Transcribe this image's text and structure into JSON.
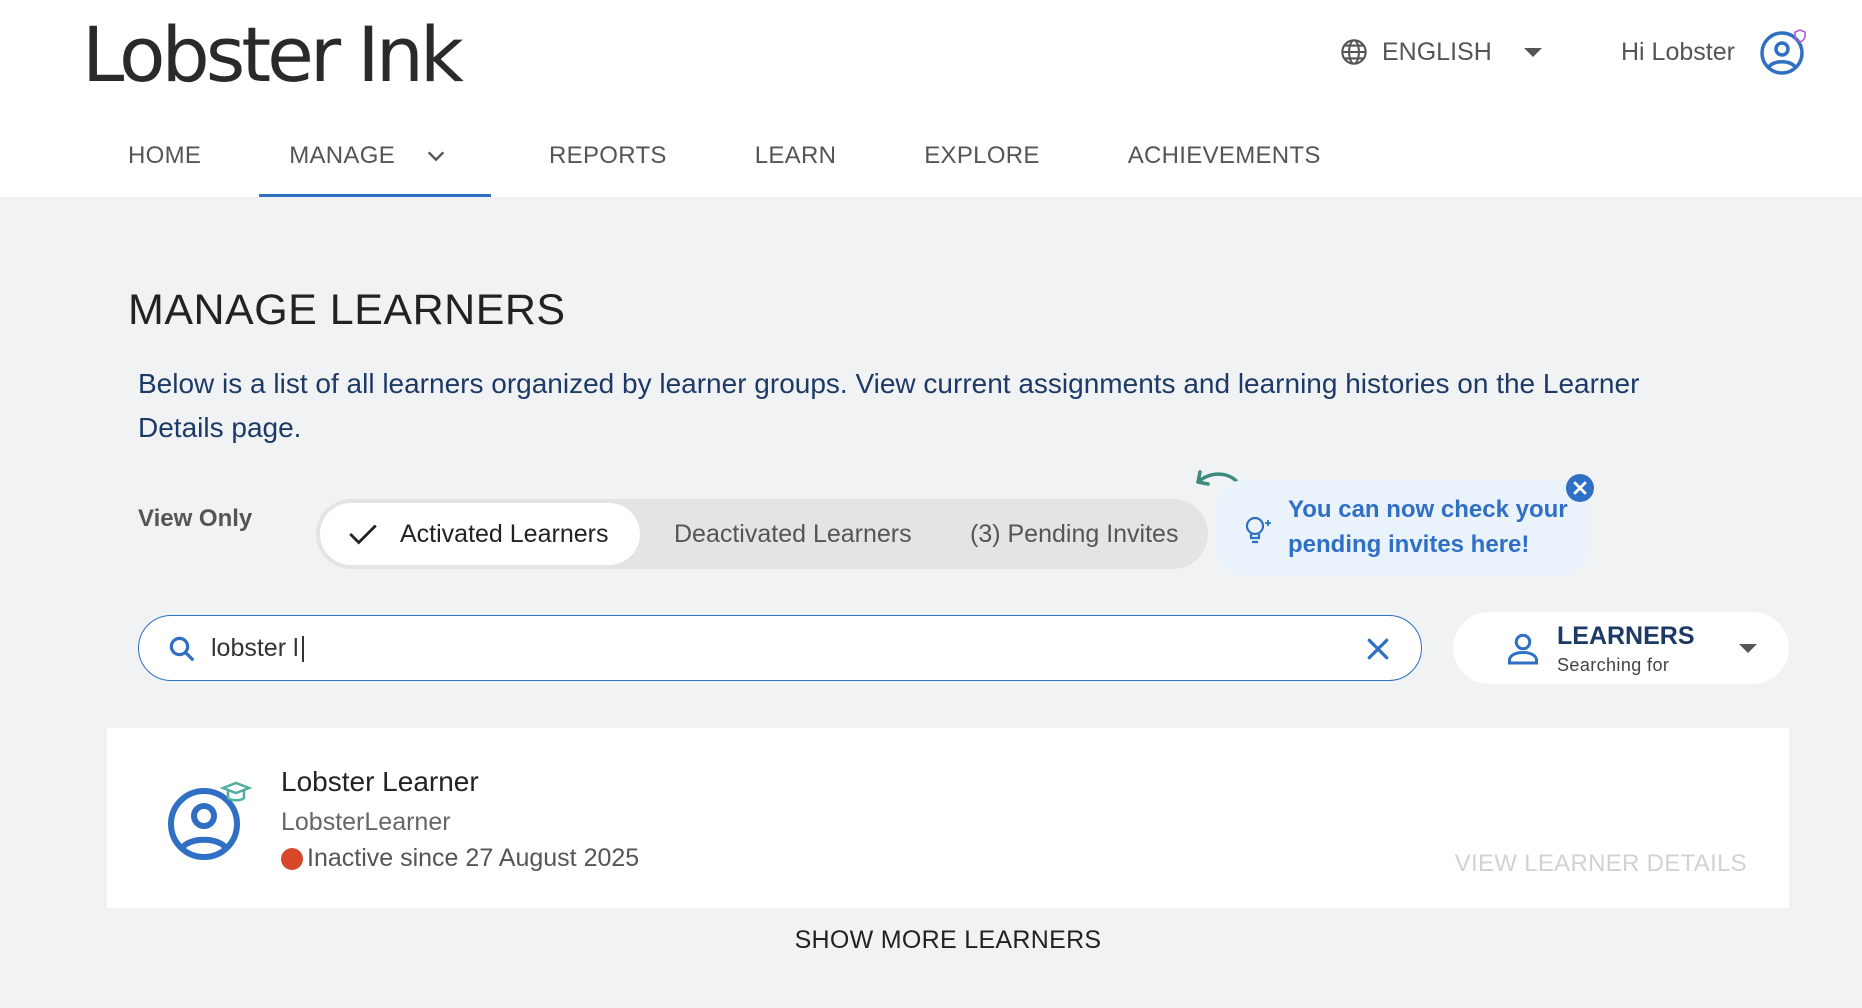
{
  "app": {
    "logo": "Lobster Ink"
  },
  "topbar": {
    "language": "ENGLISH",
    "greeting": "Hi Lobster"
  },
  "nav": {
    "items": [
      {
        "label": "HOME"
      },
      {
        "label": "MANAGE"
      },
      {
        "label": "REPORTS"
      },
      {
        "label": "LEARN"
      },
      {
        "label": "EXPLORE"
      },
      {
        "label": "ACHIEVEMENTS"
      }
    ],
    "active": "MANAGE"
  },
  "main": {
    "title": "MANAGE LEARNERS",
    "description": "Below is a list of all learners organized by learner groups. View current assignments and learning histories on the Learner Details page.",
    "view_only_label": "View Only",
    "filters": [
      {
        "label": "Activated Learners",
        "selected": true
      },
      {
        "label": "Deactivated Learners",
        "selected": false
      },
      {
        "label": "(3) Pending Invites",
        "selected": false
      }
    ],
    "tip": {
      "text": "You can now check your pending invites here!"
    },
    "search": {
      "value": "lobster l"
    },
    "scope": {
      "title": "LEARNERS",
      "subtitle": "Searching for"
    },
    "learners": [
      {
        "name": "Lobster Learner",
        "username": "LobsterLearner",
        "status": "Inactive since 27 August 2025",
        "status_color": "#d9472a",
        "action": "VIEW LEARNER DETAILS"
      }
    ],
    "show_more": "SHOW MORE LEARNERS"
  },
  "colors": {
    "accent": "#2f6fc4",
    "heading_blue": "#1d3a66",
    "tip_bg": "#eaf2fb"
  }
}
